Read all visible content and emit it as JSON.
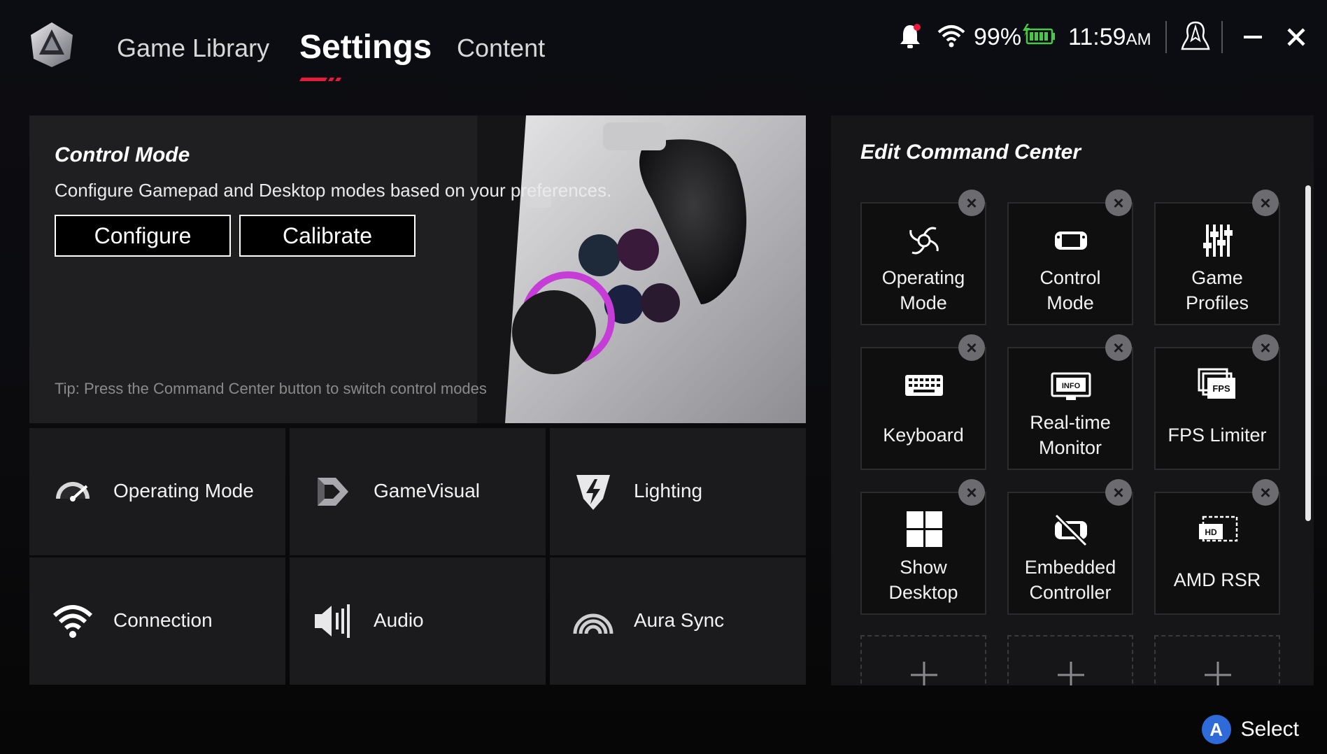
{
  "nav": {
    "game_library": "Game Library",
    "settings": "Settings",
    "content": "Content"
  },
  "status": {
    "battery_percent": "99%",
    "time": "11:59",
    "time_suffix": "AM",
    "battery_icon": "battery-charging-icon",
    "wifi_icon": "wifi-icon",
    "notification_icon": "bell-icon"
  },
  "control_mode": {
    "title": "Control Mode",
    "description": "Configure Gamepad and Desktop modes based on your preferences.",
    "configure_label": "Configure",
    "calibrate_label": "Calibrate",
    "tip": "Tip: Press the Command Center button to switch control modes"
  },
  "tiles": [
    {
      "label": "Operating Mode",
      "icon": "speedometer-icon"
    },
    {
      "label": "GameVisual",
      "icon": "gamevisual-icon"
    },
    {
      "label": "Lighting",
      "icon": "lighting-icon"
    },
    {
      "label": "Connection",
      "icon": "wifi-icon"
    },
    {
      "label": "Audio",
      "icon": "speaker-icon"
    },
    {
      "label": "Aura Sync",
      "icon": "aura-sync-icon"
    }
  ],
  "command_center": {
    "title": "Edit Command Center",
    "items": [
      {
        "line1": "Operating",
        "line2": "Mode",
        "icon": "fan-icon"
      },
      {
        "line1": "Control",
        "line2": "Mode",
        "icon": "controller-icon"
      },
      {
        "line1": "Game",
        "line2": "Profiles",
        "icon": "sliders-icon"
      },
      {
        "line1": "Keyboard",
        "line2": "",
        "icon": "keyboard-icon"
      },
      {
        "line1": "Real-time",
        "line2": "Monitor",
        "icon": "monitor-info-icon"
      },
      {
        "line1": "FPS Limiter",
        "line2": "",
        "icon": "fps-icon"
      },
      {
        "line1": "Show",
        "line2": "Desktop",
        "icon": "windows-icon"
      },
      {
        "line1": "Embedded",
        "line2": "Controller",
        "icon": "controller-off-icon"
      },
      {
        "line1": "AMD RSR",
        "line2": "",
        "icon": "hd-icon"
      }
    ],
    "monitor_badge": "INFO",
    "fps_badge": "FPS",
    "hd_badge": "HD"
  },
  "footer": {
    "a_button": "A",
    "select_label": "Select"
  },
  "colors": {
    "accent": "#e8193c",
    "tile_bg": "#1b1b1d",
    "a_button": "#2f6bd8"
  }
}
